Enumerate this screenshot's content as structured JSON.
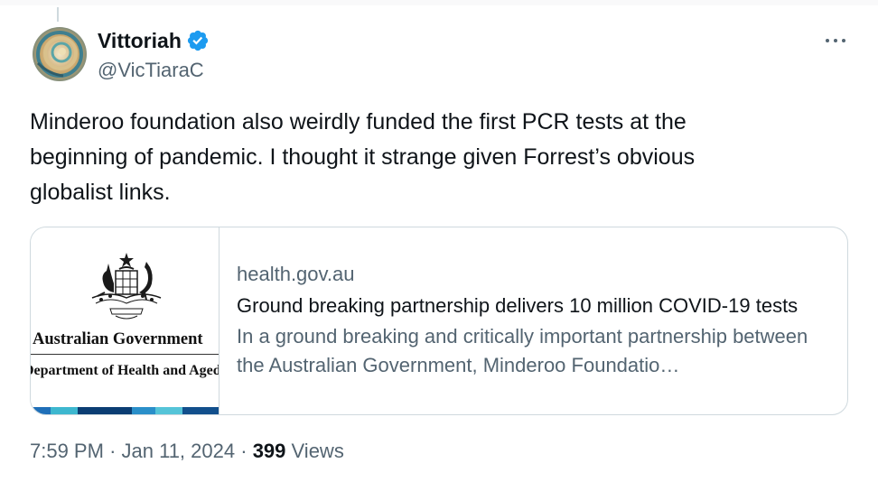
{
  "author": {
    "name": "Vittoriah",
    "handle": "@VicTiaraC",
    "verified": true,
    "verified_color": "#1d9bf0",
    "avatar_icon": "nautilus-shell-avatar"
  },
  "tweet": {
    "text": "Minderoo foundation also weirdly funded the first PCR tests at the\nbeginning of pandemic. I thought it strange given Forrest’s obvious\nglobalist links."
  },
  "card": {
    "domain": "health.gov.au",
    "title": "Ground breaking partnership delivers 10 million COVID-19 tests",
    "description": "In a ground breaking and critically important partnership between the Australian Government, Minderoo Foundatio…",
    "thumbnail": {
      "government": "Australian Government",
      "department": "Department of Health and Aged Care",
      "crest_icon": "australian-coat-of-arms-icon",
      "bar_colors": [
        "#1f6fb8",
        "#3db7cf",
        "#0b3d73",
        "#2a8fc9",
        "#55c4d8",
        "#124f8c"
      ]
    }
  },
  "meta": {
    "time": "7:59 PM",
    "date": "Jan 11, 2024",
    "views_count": "399",
    "views_label": "Views"
  },
  "colors": {
    "text_primary": "#0f1419",
    "text_secondary": "#536471",
    "border": "#cfd9de"
  }
}
